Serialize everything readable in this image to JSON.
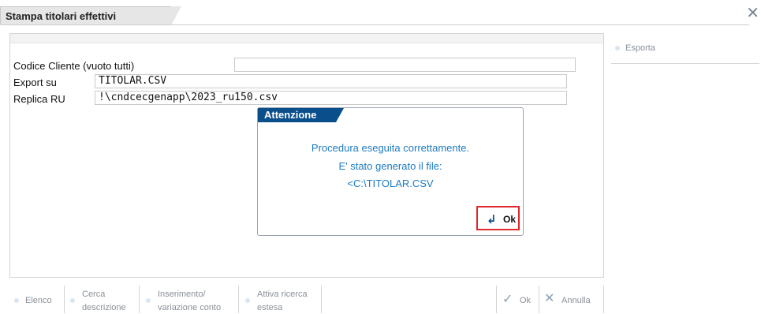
{
  "window": {
    "title": "Stampa titolari effettivi",
    "close_icon": "close-icon"
  },
  "form": {
    "codice_cliente": {
      "label": "Codice Cliente (vuoto tutti)",
      "value": ""
    },
    "export_su": {
      "label": "Export su",
      "value": "TITOLAR.CSV"
    },
    "replica_ru": {
      "label": "Replica RU",
      "value": "!\\cndcecgenapp\\2023_ru150.csv"
    }
  },
  "side_actions": [
    {
      "label": "Esporta"
    }
  ],
  "modal": {
    "title": "Attenzione",
    "line1": "Procedura eseguita correttamente.",
    "line2": "E' stato generato il file:",
    "line3": "<C:\\TITOLAR.CSV",
    "ok_label": "Ok",
    "ok_icon": "return-icon"
  },
  "toolbar": {
    "elenco": "Elenco",
    "cerca_1": "Cerca",
    "cerca_2": "descrizione",
    "inserimento_1": "Inserimento/",
    "inserimento_2": "variazione conto",
    "attiva_1": "Attiva ricerca",
    "attiva_2": "estesa",
    "ok": "Ok",
    "annulla": "Annulla"
  },
  "colors": {
    "accent": "#0a4f8c",
    "message_text": "#1e7bbf",
    "highlight_border": "#e0282e",
    "muted_text": "#8a9098"
  }
}
